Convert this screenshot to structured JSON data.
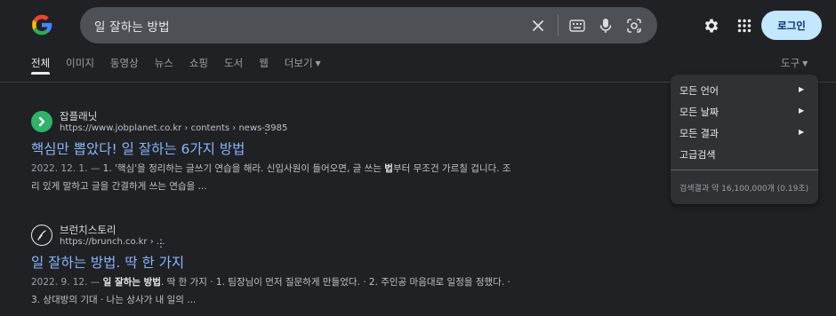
{
  "header": {
    "search_query": "일 잘하는 방법",
    "login_label": "로그인"
  },
  "tabs": [
    {
      "label": "전체",
      "active": true
    },
    {
      "label": "이미지"
    },
    {
      "label": "동영상"
    },
    {
      "label": "뉴스"
    },
    {
      "label": "쇼핑"
    },
    {
      "label": "도서"
    },
    {
      "label": "웹"
    },
    {
      "label": "더보기"
    }
  ],
  "tools_label": "도구",
  "tools_menu": {
    "items": [
      {
        "label": "모든 언어",
        "has_submenu": true
      },
      {
        "label": "모든 날짜",
        "has_submenu": true
      },
      {
        "label": "모든 결과",
        "has_submenu": true
      },
      {
        "label": "고급검색",
        "has_submenu": false
      }
    ],
    "result_stats": "검색결과 약 16,100,000개 (0.19초)"
  },
  "results": [
    {
      "site_name": "잡플래닛",
      "url": "https://www.jobplanet.co.kr › contents › news-3985",
      "title": "핵심만 뽑았다! 일 잘하는 6가지 방법",
      "date": "2022. 12. 1. —",
      "snippet_a": " 1. '핵심'을 정리하는 글쓰기 연습을 해라. 신입사원이 들어오면, 글 쓰는 ",
      "snippet_bold": "법",
      "snippet_b": "부터 무조건 가르칠 겁니다. 조리 있게 말하고 글을 간결하게 쓰는 연습을 ...",
      "icon": "chevron-right-icon",
      "icon_color": "#2fb36b"
    },
    {
      "site_name": "브런치스토리",
      "url": "https://brunch.co.kr › ...",
      "title": "일 잘하는 방법. 딱 한 가지",
      "date": "2022. 9. 12. —",
      "snippet_bold": "일 잘하는 방법",
      "snippet_a": ". 딱 한 가지 · 1. 팀장님이 먼저 질문하게 만들었다. · 2. 주인공 마음대로 일정을 정했다. · 3. 상대방의 기대 · 나는 상사가 내 일의 ...",
      "icon": "fountain-pen-icon",
      "icon_color": "#e8eaed"
    }
  ],
  "colors": {
    "background": "#202124",
    "link": "#8ab4f8",
    "login_button": "#c2e7ff"
  }
}
